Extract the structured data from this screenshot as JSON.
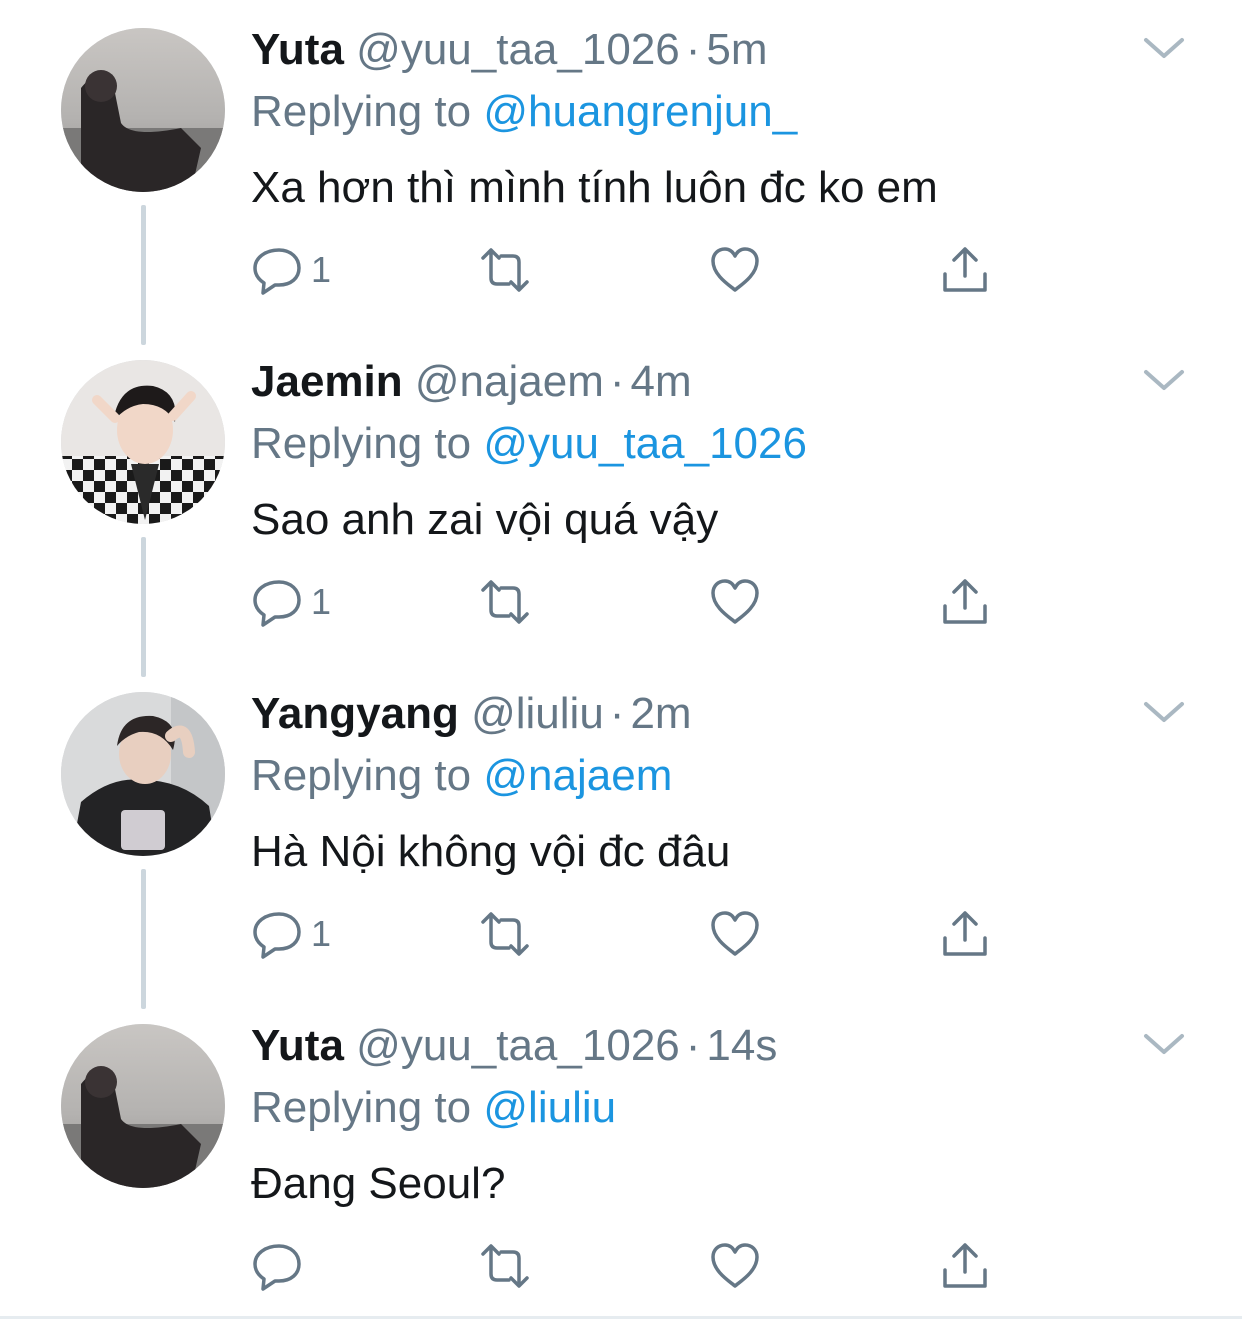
{
  "colors": {
    "link": "#1b95e0",
    "secondary_text": "#657786",
    "primary_text": "#14171a",
    "thread_line": "#ccd6dd",
    "icon": "#657786"
  },
  "icons": {
    "reply": "speech-bubble-icon",
    "retweet": "retweet-icon",
    "like": "heart-icon",
    "share": "share-icon",
    "menu": "chevron-down-icon"
  },
  "tweets": [
    {
      "name": "Yuta",
      "handle": "@yuu_taa_1026",
      "separator": "·",
      "time": "5m",
      "replying_prefix": "Replying to",
      "replying_to": "@huangrenjun_",
      "text": "Xa hơn thì mình tính luôn đc ko em",
      "reply_count": "1"
    },
    {
      "name": "Jaemin",
      "handle": "@najaem",
      "separator": "·",
      "time": "4m",
      "replying_prefix": "Replying to",
      "replying_to": "@yuu_taa_1026",
      "text": "Sao anh zai vội quá vậy",
      "reply_count": "1"
    },
    {
      "name": "Yangyang",
      "handle": "@liuliu",
      "separator": "·",
      "time": "2m",
      "replying_prefix": "Replying to",
      "replying_to": "@najaem",
      "text": "Hà Nội không vội đc đâu",
      "reply_count": "1"
    },
    {
      "name": "Yuta",
      "handle": "@yuu_taa_1026",
      "separator": "·",
      "time": "14s",
      "replying_prefix": "Replying to",
      "replying_to": "@liuliu",
      "text": "Đang Seoul?",
      "reply_count": ""
    }
  ]
}
